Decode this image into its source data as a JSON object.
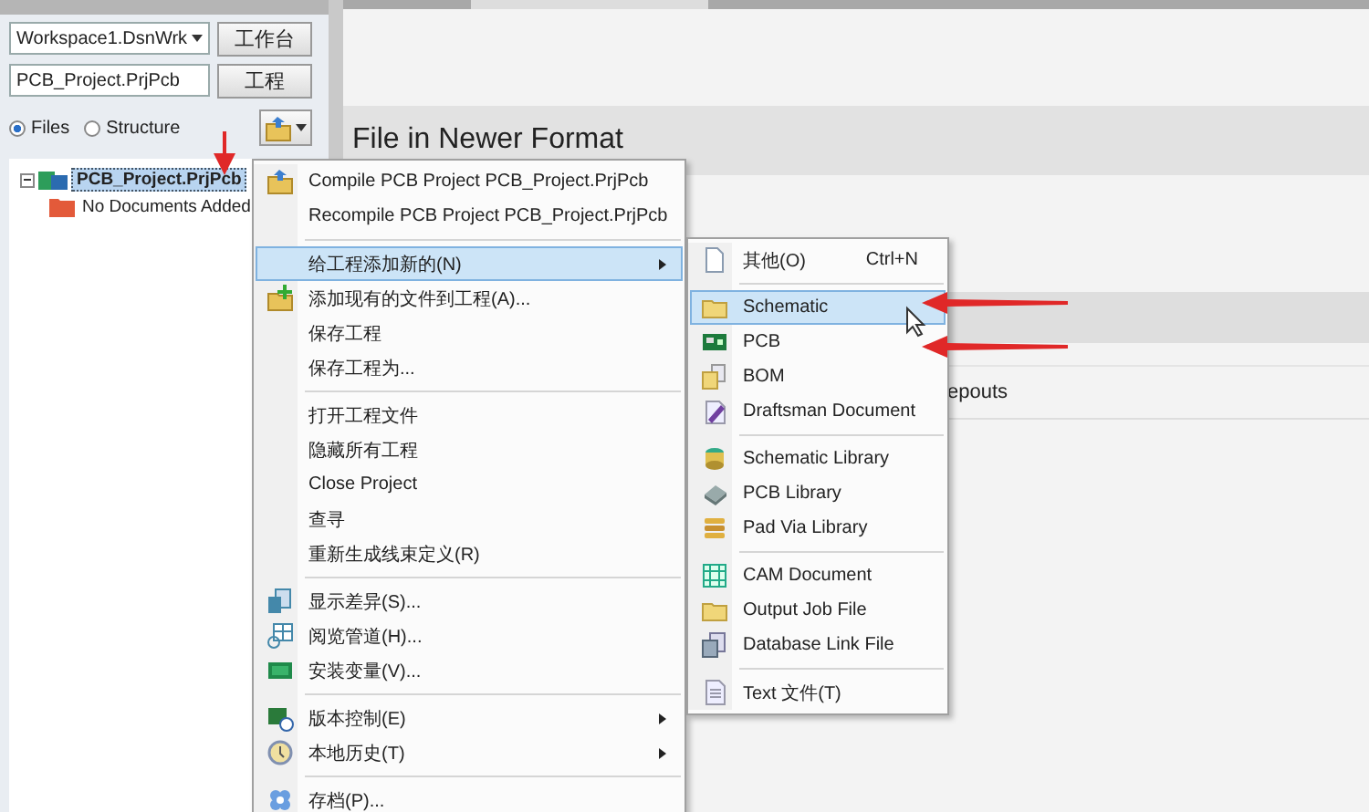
{
  "workspace": {
    "dropdown": "Workspace1.DsnWrk",
    "workspace_button": "工作台",
    "project_field": "PCB_Project.PrjPcb",
    "project_button": "工程"
  },
  "view_options": [
    {
      "label": "Files",
      "selected": true
    },
    {
      "label": "Structure",
      "selected": false
    }
  ],
  "tree": [
    {
      "label": "PCB_Project.PrjPcb",
      "selected": true,
      "expanded": true,
      "children": [
        {
          "label": "No Documents Added",
          "selected": false
        }
      ]
    }
  ],
  "content": {
    "header": "File in Newer Format",
    "row_text": "epouts"
  },
  "context_menu": [
    {
      "kind": "item",
      "label": "Compile PCB Project PCB_Project.PrjPcb",
      "selected": false,
      "has_submenu": false
    },
    {
      "kind": "item",
      "label": "Recompile PCB Project PCB_Project.PrjPcb",
      "selected": false,
      "has_submenu": false
    },
    {
      "kind": "separator"
    },
    {
      "kind": "item",
      "label": "给工程添加新的(N)",
      "selected": true,
      "has_submenu": true
    },
    {
      "kind": "item",
      "label": "添加现有的文件到工程(A)...",
      "selected": false,
      "has_submenu": false
    },
    {
      "kind": "item",
      "label": "保存工程",
      "selected": false,
      "has_submenu": false
    },
    {
      "kind": "item",
      "label": "保存工程为...",
      "selected": false,
      "has_submenu": false
    },
    {
      "kind": "separator"
    },
    {
      "kind": "item",
      "label": "打开工程文件",
      "selected": false,
      "has_submenu": false
    },
    {
      "kind": "item",
      "label": "隐藏所有工程",
      "selected": false,
      "has_submenu": false
    },
    {
      "kind": "item",
      "label": "Close Project",
      "selected": false,
      "has_submenu": false
    },
    {
      "kind": "item",
      "label": "查寻",
      "selected": false,
      "has_submenu": false
    },
    {
      "kind": "item",
      "label": "重新生成线束定义(R)",
      "selected": false,
      "has_submenu": false
    },
    {
      "kind": "separator"
    },
    {
      "kind": "item",
      "label": "显示差异(S)...",
      "selected": false,
      "has_submenu": false
    },
    {
      "kind": "item",
      "label": "阅览管道(H)...",
      "selected": false,
      "has_submenu": false
    },
    {
      "kind": "item",
      "label": "安装变量(V)...",
      "selected": false,
      "has_submenu": false
    },
    {
      "kind": "separator"
    },
    {
      "kind": "item",
      "label": "版本控制(E)",
      "selected": false,
      "has_submenu": true
    },
    {
      "kind": "item",
      "label": "本地历史(T)",
      "selected": false,
      "has_submenu": true
    },
    {
      "kind": "separator"
    },
    {
      "kind": "item",
      "label": "存档(P)...",
      "selected": false,
      "has_submenu": false
    }
  ],
  "submenu": [
    {
      "kind": "item",
      "label": "其他(O)",
      "shortcut": "Ctrl+N",
      "selected": false
    },
    {
      "kind": "separator"
    },
    {
      "kind": "item",
      "label": "Schematic",
      "selected": true
    },
    {
      "kind": "item",
      "label": "PCB",
      "selected": false
    },
    {
      "kind": "item",
      "label": "BOM",
      "selected": false
    },
    {
      "kind": "item",
      "label": "Draftsman Document",
      "selected": false
    },
    {
      "kind": "separator"
    },
    {
      "kind": "item",
      "label": "Schematic Library",
      "selected": false
    },
    {
      "kind": "item",
      "label": "PCB Library",
      "selected": false
    },
    {
      "kind": "item",
      "label": "Pad Via Library",
      "selected": false
    },
    {
      "kind": "separator"
    },
    {
      "kind": "item",
      "label": "CAM Document",
      "selected": false
    },
    {
      "kind": "item",
      "label": "Output Job File",
      "selected": false
    },
    {
      "kind": "item",
      "label": "Database Link File",
      "selected": false
    },
    {
      "kind": "separator"
    },
    {
      "kind": "item",
      "label": "Text  文件(T)",
      "selected": false
    }
  ]
}
